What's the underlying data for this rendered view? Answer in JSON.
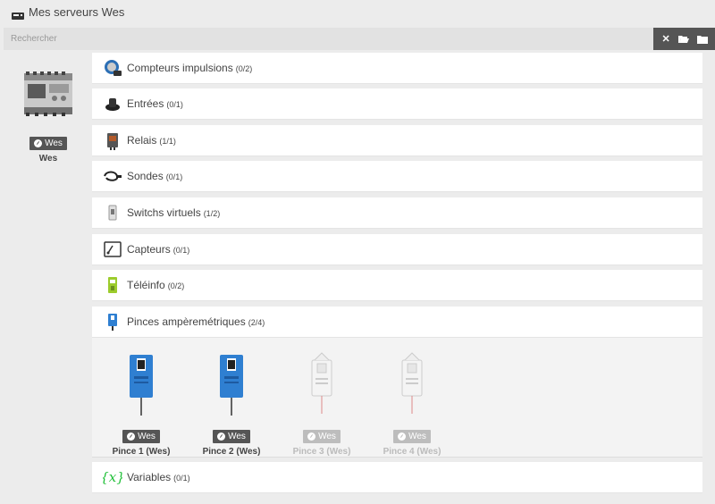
{
  "header": {
    "title": "Mes serveurs Wes",
    "icon": "server-icon"
  },
  "search": {
    "placeholder": "Rechercher",
    "value": ""
  },
  "toolbar": {
    "icons": [
      "close-icon",
      "folder-open-icon",
      "folder-icon"
    ]
  },
  "device": {
    "badge": "Wes",
    "name": "Wes"
  },
  "categories": [
    {
      "label": "Compteurs impulsions",
      "count": "(0/2)",
      "icon": "pulse-counter-icon"
    },
    {
      "label": "Entrées",
      "count": "(0/1)",
      "icon": "button-input-icon"
    },
    {
      "label": "Relais",
      "count": "(1/1)",
      "icon": "relay-icon"
    },
    {
      "label": "Sondes",
      "count": "(0/1)",
      "icon": "probe-icon"
    },
    {
      "label": "Switchs virtuels",
      "count": "(1/2)",
      "icon": "virtual-switch-icon"
    },
    {
      "label": "Capteurs",
      "count": "(0/1)",
      "icon": "sensor-icon"
    },
    {
      "label": "Téléinfo",
      "count": "(0/2)",
      "icon": "teleinfo-icon"
    },
    {
      "label": "Pinces ampèremétriques",
      "count": "(2/4)",
      "icon": "clamp-icon"
    },
    {
      "label": "Variables",
      "count": "(0/1)",
      "icon": "variable-icon"
    }
  ],
  "pinces": [
    {
      "badge": "Wes",
      "name": "Pince 1 (Wes)",
      "active": true
    },
    {
      "badge": "Wes",
      "name": "Pince 2 (Wes)",
      "active": true
    },
    {
      "badge": "Wes",
      "name": "Pince 3 (Wes)",
      "active": false
    },
    {
      "badge": "Wes",
      "name": "Pince 4 (Wes)",
      "active": false
    }
  ],
  "colors": {
    "accent_dark": "#555555",
    "clamp_blue": "#2f7fd1",
    "variable_green": "#22c03a",
    "teleinfo_green": "#9ccc2c"
  }
}
